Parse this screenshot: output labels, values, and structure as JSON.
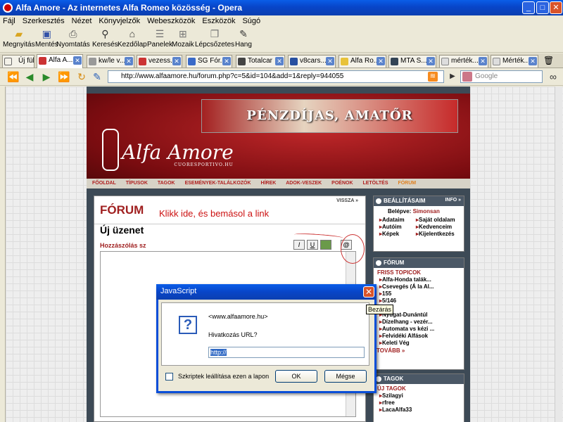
{
  "window": {
    "title": "Alfa Amore - Az internetes Alfa Romeo közösség - Opera"
  },
  "menu": [
    "Fájl",
    "Szerkesztés",
    "Nézet",
    "Könyvjelzők",
    "Webeszközök",
    "Eszközök",
    "Súgó"
  ],
  "toolbar": [
    {
      "label": "Megnyitás",
      "icon": "folder-icon"
    },
    {
      "label": "Mentés",
      "icon": "save-icon"
    },
    {
      "label": "Nyomtatás",
      "icon": "print-icon"
    },
    {
      "label": "Keresés",
      "icon": "search-icon"
    },
    {
      "label": "Kezdőlap",
      "icon": "home-icon"
    },
    {
      "label": "Panelek",
      "icon": "panels-icon"
    },
    {
      "label": "Mozaik",
      "icon": "tile-icon"
    },
    {
      "label": "Lépcsőzetes",
      "icon": "cascade-icon"
    },
    {
      "label": "Hang",
      "icon": "voice-icon"
    }
  ],
  "tabs": {
    "new_tab": "Új fül",
    "items": [
      "Alfa A...",
      "kw/le v...",
      "vezess...",
      "SG Fór...",
      "Totalcar",
      "v8cars...",
      "Alfa Ro...",
      "MTA S...",
      "mérték...",
      "Mérték..."
    ]
  },
  "address": {
    "url": "http://www.alfaamore.hu/forum.php?c=5&id=104&add=1&reply=944055",
    "search_placeholder": "Google"
  },
  "site": {
    "ad_text": "PÉNZDÍJAS, AMATŐR",
    "logo": "Alfa Amore",
    "logo_sub": "CUORESPORTIVO.HU",
    "nav": [
      "FŐOLDAL",
      "TÍPUSOK",
      "TAGOK",
      "ESEMÉNYEK-TALÁLKOZÓK",
      "HÍREK",
      "ADOK-VESZEK",
      "POÉNOK",
      "LETÖLTÉS",
      "FÓRUM"
    ],
    "forum_title": "FÓRUM",
    "back": "VISSZA »",
    "new_message": "Új üzenet",
    "comment_label": "Hozzászólás sz"
  },
  "right": {
    "settings_title": "BEÁLLÍTÁSAIM",
    "info": "INFO »",
    "login": "Belépve:",
    "user": "Simonsan",
    "links": [
      "Adataim",
      "Saját oldalam",
      "Autóim",
      "Kedvenceim",
      "Képek",
      "Kijelentkezés"
    ],
    "forum_title": "FÓRUM",
    "fresh_title": "FRISS TOPICOK",
    "topics": [
      "Alfa-Honda talák...",
      "Csevegés (Á la Al...",
      "155",
      "5/146",
      "7",
      "Nyugat-Dunántúl",
      "Dízelhang - vezér...",
      "Automata vs kézi ...",
      "Felvidéki Alfások",
      "Keleti Vég"
    ],
    "more": "TOVÁBB »",
    "members_title": "TAGOK",
    "new_members_title": "ÚJ TAGOK",
    "members": [
      "Szilagyi",
      "rfree",
      "LacaAlfa33"
    ]
  },
  "annotation": {
    "text": "Klikk ide, és bemásol a link"
  },
  "dialog": {
    "title": "JavaScript",
    "origin": "<www.alfaamore.hu>",
    "prompt": "Hivatkozás URL?",
    "value": "http://",
    "checkbox_label": "Szkriptek leállítása ezen a lapon",
    "ok": "OK",
    "cancel": "Mégse",
    "close_tooltip": "Bezárás"
  }
}
